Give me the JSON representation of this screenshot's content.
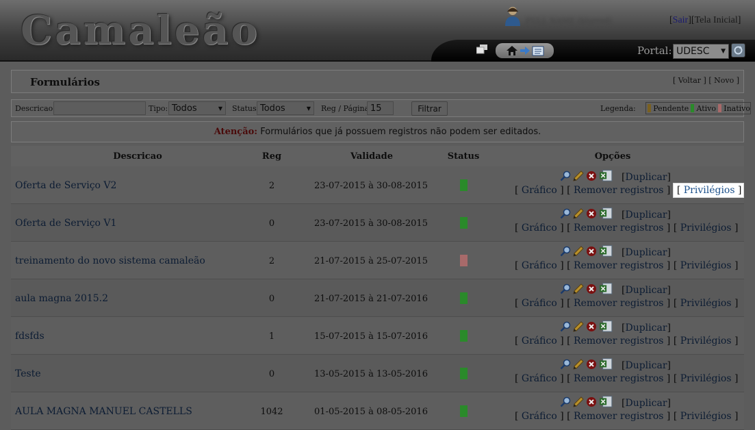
{
  "header": {
    "logo": "Camaleão",
    "user_name_blurred": "FULL NAME (blurred)",
    "links": {
      "open_bracket": "[",
      "logout": "Sair",
      "mid": "][",
      "home": "Tela Inicial",
      "close_bracket": "]"
    },
    "portal_label": "Portal:",
    "portal_value": "UDESC"
  },
  "page": {
    "title": "Formulários",
    "voltar": "[ Voltar ]",
    "novo": "[ Novo ]"
  },
  "filters": {
    "descricao_label": "Descricao:",
    "descricao_value": "",
    "tipo_label": "Tipo:",
    "tipo_value": "Todos",
    "status_label": "Status:",
    "status_value": "Todos",
    "per_page_label": "Reg / Página:",
    "per_page_value": "15",
    "filter_button": "Filtrar",
    "legend_label": "Legenda:",
    "legend": [
      {
        "label": "Pendente",
        "color": "#7a6020"
      },
      {
        "label": "Ativo",
        "color": "#2a8a2a"
      },
      {
        "label": "Inativo",
        "color": "#a86a6a"
      }
    ]
  },
  "warning": {
    "label": "Atenção:",
    "text": " Formulários que já possuem registros não podem ser editados."
  },
  "table": {
    "headers": {
      "descricao": "Descricao",
      "reg": "Reg",
      "validade": "Validade",
      "status": "Status",
      "opcoes": "Opções"
    },
    "action_labels": {
      "duplicar": "Duplicar",
      "grafico": "Gráfico",
      "remover": "Remover registros",
      "privilegios": "Privilégios"
    },
    "rows": [
      {
        "descricao": "Oferta de Serviço V2",
        "reg": "2",
        "validade": "23-07-2015 à 30-08-2015",
        "status": "ativo"
      },
      {
        "descricao": "Oferta de Serviço V1",
        "reg": "0",
        "validade": "23-07-2015 à 30-08-2015",
        "status": "ativo"
      },
      {
        "descricao": "treinamento do novo sistema camaleão",
        "reg": "2",
        "validade": "21-07-2015 à 25-07-2015",
        "status": "inativo"
      },
      {
        "descricao": "aula magna 2015.2",
        "reg": "0",
        "validade": "21-07-2015 à 21-07-2016",
        "status": "ativo"
      },
      {
        "descricao": "fdsfds",
        "reg": "1",
        "validade": "15-07-2015 à 15-07-2016",
        "status": "ativo"
      },
      {
        "descricao": "Teste",
        "reg": "0",
        "validade": "13-05-2015 à 13-05-2016",
        "status": "ativo"
      },
      {
        "descricao": "AULA MAGNA MANUEL CASTELLS",
        "reg": "1042",
        "validade": "01-05-2015 à 08-05-2016",
        "status": "ativo"
      }
    ]
  },
  "colors": {
    "ativo": "#2a8a2a",
    "inativo": "#a86a6a",
    "highlight": "#ffffff"
  }
}
